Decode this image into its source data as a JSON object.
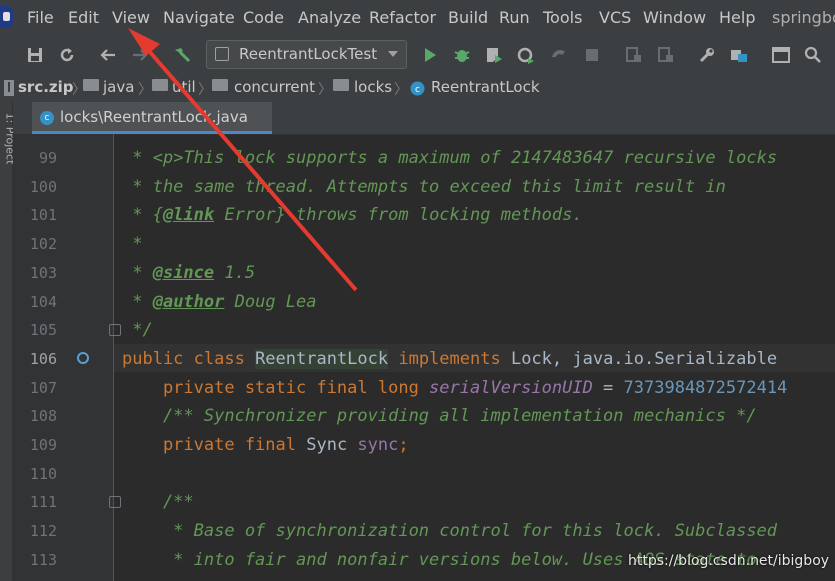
{
  "menu": {
    "items": [
      "File",
      "Edit",
      "View",
      "Navigate",
      "Code",
      "Analyze",
      "Refactor",
      "Build",
      "Run",
      "Tools",
      "VCS",
      "Window",
      "Help"
    ],
    "project": "springbo"
  },
  "toolbar": {
    "run_config": "ReentrantLockTest",
    "icons": [
      "save-all-icon",
      "sync-icon",
      "back-arrow-icon",
      "forward-arrow-icon",
      "build-hammer-icon",
      "run-icon",
      "debug-icon",
      "coverage-icon",
      "profile-icon",
      "attach-icon",
      "stop-icon",
      "settings-wrench-icon",
      "project-structure-icon",
      "terminal-icon",
      "search-icon"
    ]
  },
  "breadcrumbs": {
    "items": [
      "src.zip",
      "java",
      "util",
      "concurrent",
      "locks",
      "ReentrantLock"
    ]
  },
  "sidebar": {
    "label": "1: Project"
  },
  "tab": {
    "label": "locks\\ReentrantLock.java"
  },
  "editor": {
    "line_numbers": [
      "99",
      "100",
      "101",
      "102",
      "103",
      "104",
      "105",
      "106",
      "107",
      "108",
      "109",
      "110",
      "111",
      "112",
      "113"
    ],
    "current_line": "106",
    "code": {
      "l99a": " * ",
      "l99b": "<p>",
      "l99c": "This lock supports a maximum of 2147483647 recursive locks",
      "l100": " * the same thread. Attempts to exceed this limit result in",
      "l101a": " * {",
      "l101b": "@link",
      "l101c": " Error} throws from locking methods.",
      "l102": " *",
      "l103a": " * ",
      "l103b": "@since",
      "l103c": " 1.5",
      "l104a": " * ",
      "l104b": "@author",
      "l104c": " Doug Lea",
      "l105": " */",
      "l106a": "public class ",
      "l106b": "ReentrantLock",
      "l106c": " implements ",
      "l106d": "Lock, java.io.Serializable",
      "l107a": "    private static final long ",
      "l107b": "serialVersionUID",
      "l107c": " = ",
      "l107d": "7373984872572414",
      "l108": "    /** Synchronizer providing all implementation mechanics */",
      "l109a": "    private final ",
      "l109b": "Sync ",
      "l109c": "sync",
      "l109d": ";",
      "l110": "",
      "l111": "    /**",
      "l112": "     * Base of synchronization control for this lock. Subclassed",
      "l113": "     * into fair and nonfair versions below. Uses AQS state to"
    }
  },
  "watermark": "https://blog.csdn.net/ibigboy",
  "colors": {
    "keyword": "#cc7832",
    "comment": "#629755",
    "number": "#6897bb",
    "field": "#9876aa",
    "text": "#a9b7c6",
    "annotation_arrow": "#e53a2f"
  }
}
